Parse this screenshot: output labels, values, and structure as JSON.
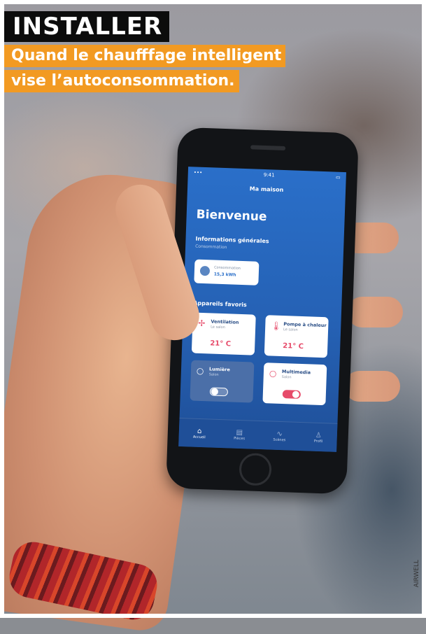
{
  "header": {
    "title": "INSTALLER",
    "subtitle_line1": "Quand le chaufffage intelligent",
    "subtitle_line2": "vise l’autoconsommation."
  },
  "colors": {
    "title_bg": "#0c0c0c",
    "subtitle_bg": "#f29a22",
    "app_blue": "#2a6fc9",
    "accent_pink": "#e64b6a"
  },
  "app": {
    "status_time": "9:41",
    "nav_title": "Ma maison",
    "welcome": "Bienvenue",
    "general_info": {
      "heading": "Informations générales",
      "subheading": "Consommation",
      "card_label": "Consommation",
      "card_value": "15,3 kWh"
    },
    "favorites": {
      "heading": "Appareils favoris",
      "devices": [
        {
          "name": "Ventilation",
          "sub": "Le salon",
          "temp": "21° C",
          "icon": "fan-icon"
        },
        {
          "name": "Pompe à chaleur",
          "sub": "Le salon",
          "temp": "21° C",
          "icon": "thermometer-icon"
        },
        {
          "name": "Lumière",
          "sub": "Salon",
          "toggle": "off",
          "icon": "bulb-icon"
        },
        {
          "name": "Multimedia",
          "sub": "Salon",
          "toggle": "on",
          "icon": "bulb-icon"
        }
      ]
    },
    "tabs": [
      {
        "label": "Accueil",
        "icon": "home-icon"
      },
      {
        "label": "Pièces",
        "icon": "rooms-icon"
      },
      {
        "label": "Scènes",
        "icon": "scenes-icon"
      },
      {
        "label": "Profil",
        "icon": "profile-icon"
      }
    ]
  },
  "credit": "AIRWELL"
}
